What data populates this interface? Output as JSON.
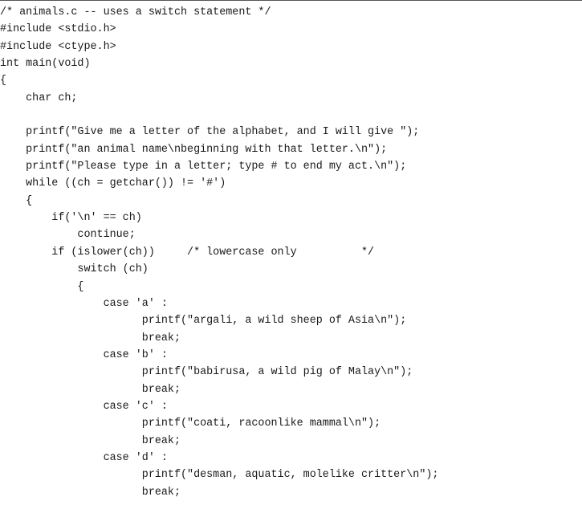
{
  "document": {
    "lines": [
      "/* animals.c -- uses a switch statement */",
      "#include <stdio.h>",
      "#include <ctype.h>",
      "int main(void)",
      "{",
      "    char ch;",
      "",
      "    printf(\"Give me a letter of the alphabet, and I will give \");",
      "    printf(\"an animal name\\nbeginning with that letter.\\n\");",
      "    printf(\"Please type in a letter; type # to end my act.\\n\");",
      "    while ((ch = getchar()) != '#')",
      "    {",
      "        if('\\n' == ch)",
      "            continue;",
      "        if (islower(ch))     /* lowercase only          */",
      "            switch (ch)",
      "            {",
      "                case 'a' :",
      "                      printf(\"argali, a wild sheep of Asia\\n\");",
      "                      break;",
      "                case 'b' :",
      "                      printf(\"babirusa, a wild pig of Malay\\n\");",
      "                      break;",
      "                case 'c' :",
      "                      printf(\"coati, racoonlike mammal\\n\");",
      "                      break;",
      "                case 'd' :",
      "                      printf(\"desman, aquatic, molelike critter\\n\");",
      "                      break;"
    ]
  }
}
